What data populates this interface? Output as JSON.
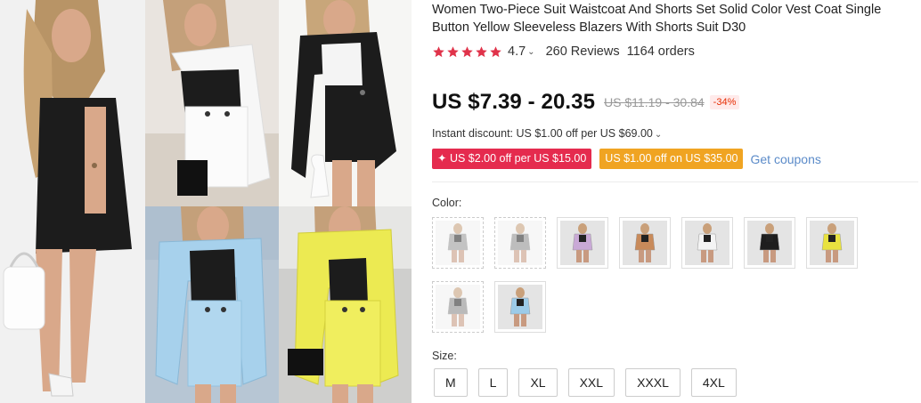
{
  "product": {
    "title": "Women Two-Piece Suit Waistcoat And Shorts Set Solid Color Vest Coat Single Button Yellow Sleeveless Blazers With Shorts Suit D30"
  },
  "rating": {
    "stars": 5,
    "value": "4.7",
    "chevron": "⌄",
    "reviews": "260 Reviews",
    "orders": "1164 orders",
    "star_color": "#e0334a"
  },
  "price": {
    "current": "US $7.39 - 20.35",
    "original": "US $11.19 - 30.84",
    "discount": "-34%"
  },
  "instant_discount": {
    "text": "Instant discount: US $1.00 off per US $69.00",
    "chevron": "⌄"
  },
  "coupons": {
    "items": [
      {
        "text": "✦ US $2.00 off per US $15.00",
        "color": "#e52b4e"
      },
      {
        "text": "US $1.00 off on US $35.00",
        "color": "#f0a422"
      }
    ],
    "get_label": "Get coupons"
  },
  "color": {
    "label": "Color:",
    "options": [
      {
        "name": "gray-a",
        "tone": "#9a9a9a",
        "faded": true
      },
      {
        "name": "gray-b",
        "tone": "#8e8e8e",
        "faded": true
      },
      {
        "name": "lilac",
        "tone": "#c9a9d6",
        "faded": false
      },
      {
        "name": "khaki",
        "tone": "#c88a5a",
        "faded": false
      },
      {
        "name": "white",
        "tone": "#f4f4f4",
        "faded": false
      },
      {
        "name": "black",
        "tone": "#1e1e1e",
        "faded": false
      },
      {
        "name": "yellow",
        "tone": "#e8e240",
        "faded": false
      },
      {
        "name": "gray-c",
        "tone": "#8a8a8a",
        "faded": true
      },
      {
        "name": "blue",
        "tone": "#9ccbe8",
        "faded": false
      }
    ]
  },
  "size": {
    "label": "Size:",
    "options": [
      "M",
      "L",
      "XL",
      "XXL",
      "XXXL",
      "4XL"
    ]
  },
  "colors": {
    "price": "#111111",
    "strike": "#999999",
    "link": "#5b8bc9",
    "hair": "#b89466",
    "skin": "#d9a88a",
    "black_vest": "#1c1c1c",
    "white_vest": "#f7f7f7",
    "blue_vest": "#a7d1ec",
    "yellow_vest": "#ecea52"
  }
}
